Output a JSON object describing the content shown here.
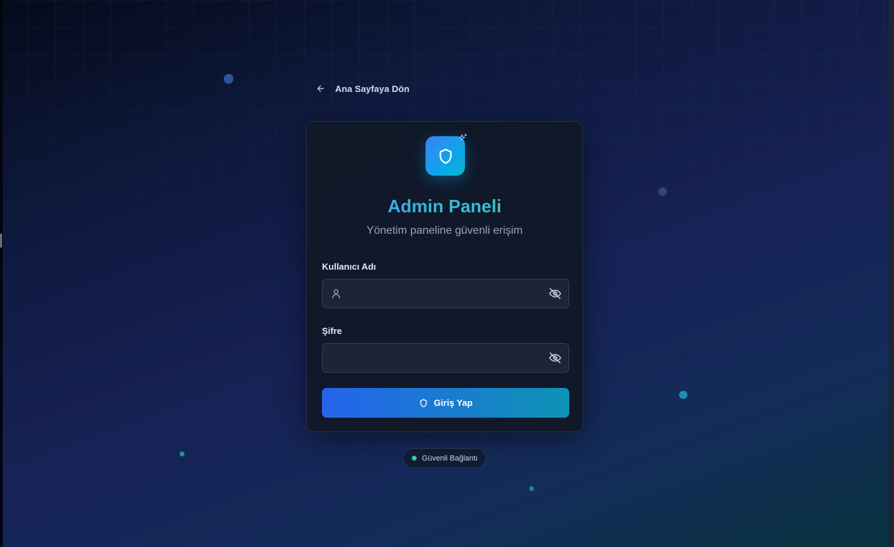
{
  "colors": {
    "accent_blue": "#2563eb",
    "accent_cyan": "#0e93b5",
    "status_green": "#34d399",
    "card_bg": "#111828"
  },
  "back_link": {
    "label": "Ana Sayfaya Dön",
    "icon": "arrow-left-icon"
  },
  "header": {
    "logo_icon": "shield-icon",
    "sparkle_icon": "sparkles-icon",
    "title": "Admin Paneli",
    "subtitle": "Yönetim paneline güvenli erişim"
  },
  "form": {
    "username": {
      "label": "Kullanıcı Adı",
      "value": "",
      "placeholder": "",
      "icon": "user-icon",
      "toggle_icon": "eye-off-icon"
    },
    "password": {
      "label": "Şifre",
      "value": "",
      "placeholder": "",
      "toggle_icon": "eye-off-icon"
    },
    "submit": {
      "label": "Giriş Yap",
      "icon": "shield-icon"
    }
  },
  "status": {
    "label": "Güvenli Bağlantı",
    "indicator": "online"
  }
}
